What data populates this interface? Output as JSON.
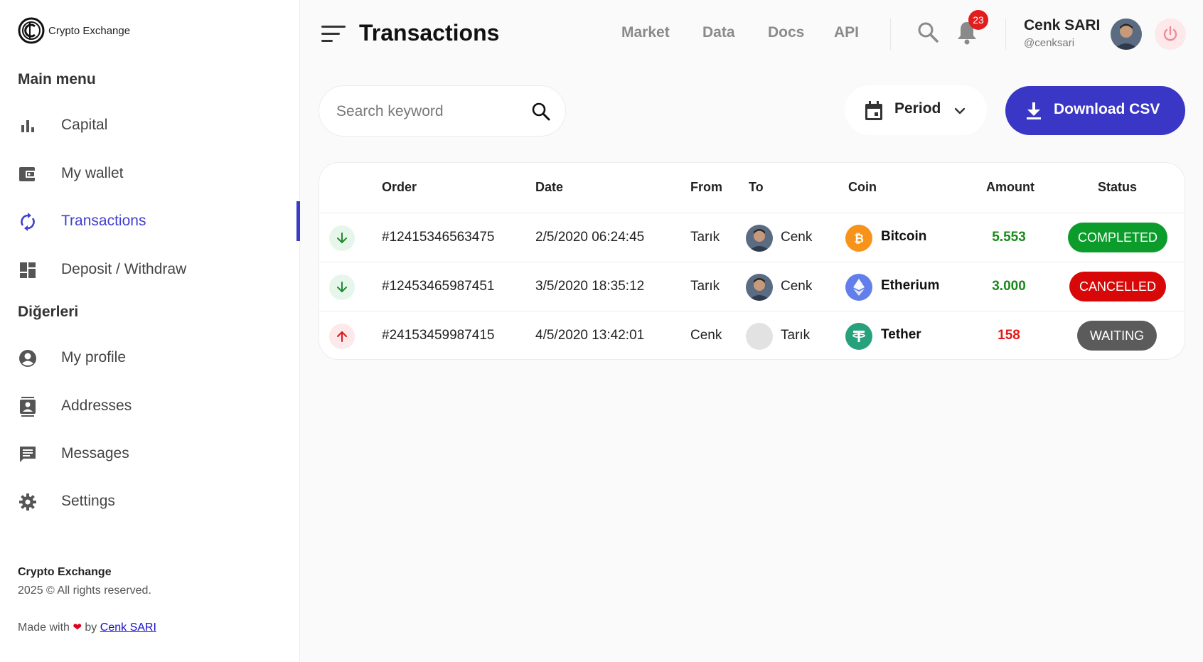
{
  "brand": {
    "name": "Crypto Exchange"
  },
  "sidebar": {
    "main_menu_title": "Main menu",
    "main_items": [
      {
        "label": "Capital",
        "icon": "bar-chart-icon"
      },
      {
        "label": "My wallet",
        "icon": "wallet-icon"
      },
      {
        "label": "Transactions",
        "icon": "sync-icon",
        "active": true
      },
      {
        "label": "Deposit / Withdraw",
        "icon": "dashboard-icon"
      }
    ],
    "other_title": "Diğerleri",
    "other_items": [
      {
        "label": "My profile",
        "icon": "account-circle-icon"
      },
      {
        "label": "Addresses",
        "icon": "contacts-icon"
      },
      {
        "label": "Messages",
        "icon": "message-icon"
      },
      {
        "label": "Settings",
        "icon": "gear-icon"
      }
    ],
    "footer": {
      "brand": "Crypto Exchange",
      "copyright": "2025 © All rights reserved.",
      "made_with": "Made with",
      "by": "by",
      "author_link": "Cenk SARI"
    }
  },
  "header": {
    "title": "Transactions",
    "nav": [
      "Market",
      "Data",
      "Docs",
      "API"
    ],
    "notification_count": "23",
    "user": {
      "name": "Cenk SARI",
      "handle": "@cenksari"
    }
  },
  "toolbar": {
    "search_placeholder": "Search keyword",
    "period_label": "Period",
    "download_label": "Download CSV"
  },
  "table": {
    "columns": [
      "Order",
      "Date",
      "From",
      "To",
      "Coin",
      "Amount",
      "Status"
    ],
    "rows": [
      {
        "direction": "in",
        "order": "#12415346563475",
        "date": "2/5/2020 06:24:45",
        "from": "Tarık",
        "to": "Cenk",
        "to_avatar": true,
        "coin": "Bitcoin",
        "coin_icon": "bitcoin-icon",
        "amount": "5.553",
        "amount_type": "positive",
        "status": "COMPLETED"
      },
      {
        "direction": "in",
        "order": "#12453465987451",
        "date": "3/5/2020 18:35:12",
        "from": "Tarık",
        "to": "Cenk",
        "to_avatar": true,
        "coin": "Etherium",
        "coin_icon": "ethereum-icon",
        "amount": "3.000",
        "amount_type": "positive",
        "status": "CANCELLED"
      },
      {
        "direction": "out",
        "order": "#24153459987415",
        "date": "4/5/2020 13:42:01",
        "from": "Cenk",
        "to": "Tarık",
        "to_avatar": false,
        "coin": "Tether",
        "coin_icon": "tether-icon",
        "amount": "158",
        "amount_type": "negative",
        "status": "WAITING"
      }
    ]
  },
  "colors": {
    "accent": "#3a36c6",
    "completed": "#0c9c2c",
    "cancelled": "#d90808",
    "waiting": "#5b5b5b",
    "positive": "#1a8a1a",
    "negative": "#e01818",
    "bitcoin": "#f7931a",
    "ethereum": "#627eea",
    "tether": "#26a17b"
  }
}
